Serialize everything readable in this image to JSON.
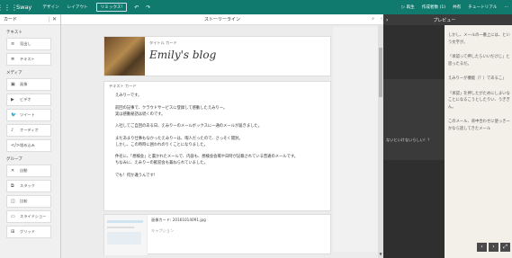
{
  "topbar": {
    "brand": "Sway",
    "menu": [
      "デザイン",
      "レイアウト"
    ],
    "remix_label": "リミックス!",
    "undo_icon": "undo-icon",
    "redo_icon": "redo-icon",
    "right": [
      "▷ 再生",
      "作成者数 (1)",
      "共有",
      "チュートリアル",
      "⋯"
    ]
  },
  "cards_panel": {
    "title": "カード",
    "sections": [
      {
        "label": "テキスト",
        "items": [
          {
            "icon": "≡",
            "label": "見出し"
          },
          {
            "icon": "≣",
            "label": "テキスト"
          }
        ]
      },
      {
        "label": "メディア",
        "items": [
          {
            "icon": "▣",
            "label": "画像"
          },
          {
            "icon": "▶",
            "label": "ビデオ"
          },
          {
            "icon": "🐦",
            "label": "ツイート"
          },
          {
            "icon": "♪",
            "label": "オーディオ"
          },
          {
            "icon": "</>",
            "label": "埋め込み"
          }
        ]
      },
      {
        "label": "グループ",
        "items": [
          {
            "icon": "✕",
            "label": "自動"
          },
          {
            "icon": "⧉",
            "label": "スタック"
          },
          {
            "icon": "◫",
            "label": "比較"
          },
          {
            "icon": "▭",
            "label": "スライドショー"
          },
          {
            "icon": "⊞",
            "label": "グリッド"
          }
        ]
      }
    ]
  },
  "storyline": {
    "title": "ストーリーライン",
    "title_card": {
      "label": "タイトル カード",
      "title": "Emily's blog"
    },
    "text_card": {
      "label": "テキスト カード",
      "paragraphs": [
        "えみりーです。",
        "前回の記事で、クラウドサービスに登録して感動したえみりー。\n実は感動秘話は続くのです。",
        "入社してご自回のある日、えみりーのメールボックスに一通のメールが届きました。",
        "まだあまり仕事もなかったえみりーは、暇人だったので、さっそく開封。\nしかし、この時時に囲われのりくことになりました。",
        "件名に、「想検会」と書かれたメールで、内容も、想検会会場や日時が記載されている普通のメールです。\nちなみに、えみりーの歓迎会も兼ねられていました。",
        "でも！何か違うんです！"
      ]
    },
    "image_card": {
      "filename": "画像カード: 20161014091.jpg",
      "caption": "キャプション"
    }
  },
  "preview": {
    "title": "プレビュー",
    "paragraphs": [
      "しかし、メールの一番上には、という文字が。",
      "「承認って押したらいいだけじ」と思ったるだ。",
      "えみりーが機能（？）であるこ」",
      "「承認」を押したがためにしまいなことになるこうとしたりい、うぎぎん。",
      "このメール、背中合わせに使っきーかなら話してきたメール"
    ],
    "overflow_text": "ないといけないらしい！？"
  }
}
